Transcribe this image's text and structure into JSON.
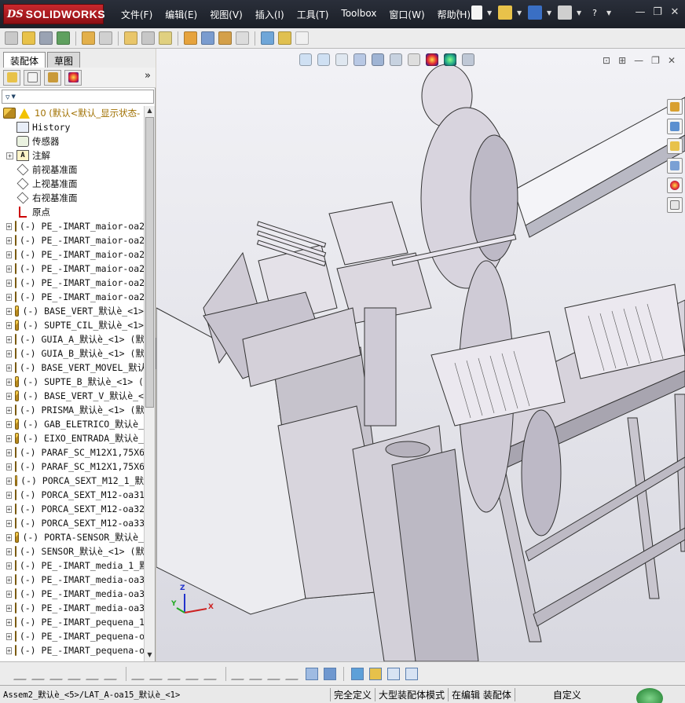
{
  "app": {
    "logo_ds": "DS",
    "logo_name": "SOLIDWORKS"
  },
  "menu": [
    "文件(F)",
    "编辑(E)",
    "视图(V)",
    "插入(I)",
    "工具(T)",
    "Toolbox",
    "窗口(W)",
    "帮助(H)"
  ],
  "window_buttons": {
    "minimize": "—",
    "restore": "❐",
    "close": "✕"
  },
  "panel": {
    "tabs": [
      "装配体",
      "草图"
    ],
    "active_tab": 0,
    "expand_label": "»",
    "filter_icon": "▼"
  },
  "tree": {
    "root": "10  (默认<默认_显示状态-",
    "items": [
      {
        "icon": "history-icon",
        "label": "History",
        "expand": false
      },
      {
        "icon": "sensor-icon",
        "label": "传感器",
        "expand": false
      },
      {
        "icon": "annotation-icon",
        "label": "注解",
        "expand": true
      },
      {
        "icon": "plane-icon",
        "label": "前视基准面",
        "expand": false
      },
      {
        "icon": "plane-icon",
        "label": "上视基准面",
        "expand": false
      },
      {
        "icon": "plane-icon",
        "label": "右视基准面",
        "expand": false
      },
      {
        "icon": "origin-icon",
        "label": "原点",
        "expand": false
      },
      {
        "icon": "part-icon",
        "label": "(-) PE_-IMART_maior-oa2",
        "expand": true
      },
      {
        "icon": "part-icon",
        "label": "(-) PE_-IMART_maior-oa2",
        "expand": true
      },
      {
        "icon": "part-icon",
        "label": "(-) PE_-IMART_maior-oa2",
        "expand": true
      },
      {
        "icon": "part-icon",
        "label": "(-) PE_-IMART_maior-oa2",
        "expand": true
      },
      {
        "icon": "part-icon",
        "label": "(-) PE_-IMART_maior-oa2",
        "expand": true
      },
      {
        "icon": "part-icon",
        "label": "(-) PE_-IMART_maior-oa2",
        "expand": true
      },
      {
        "icon": "part-icon",
        "label": "(-) BASE_VERT_默认è_<1>",
        "expand": true
      },
      {
        "icon": "part-icon",
        "label": "(-) SUPTE_CIL_默认è_<1>",
        "expand": true
      },
      {
        "icon": "part-icon",
        "label": "(-) GUIA_A_默认è_<1> (默",
        "expand": true
      },
      {
        "icon": "part-icon",
        "label": "(-) GUIA_B_默认è_<1> (默",
        "expand": true
      },
      {
        "icon": "part-icon",
        "label": "(-) BASE_VERT_MOVEL_默认",
        "expand": true
      },
      {
        "icon": "part-icon",
        "label": "(-) SUPTE_B_默认è_<1> (",
        "expand": true
      },
      {
        "icon": "part-icon",
        "label": "(-) BASE_VERT_V_默认è_<",
        "expand": true
      },
      {
        "icon": "part-icon",
        "label": "(-) PRISMA_默认è_<1> (默",
        "expand": true
      },
      {
        "icon": "part-icon",
        "label": "(-) GAB_ELETRICO_默认è_",
        "expand": true
      },
      {
        "icon": "part-icon",
        "label": "(-) EIXO_ENTRADA_默认è_",
        "expand": true
      },
      {
        "icon": "part-icon",
        "label": "(-) PARAF_SC_M12X1,75X6",
        "expand": true
      },
      {
        "icon": "part-icon",
        "label": "(-) PARAF_SC_M12X1,75X6",
        "expand": true
      },
      {
        "icon": "part-icon",
        "label": "(-) PORCA_SEXT_M12_1_默",
        "expand": true
      },
      {
        "icon": "part-icon",
        "label": "(-) PORCA_SEXT_M12-oa31",
        "expand": true
      },
      {
        "icon": "part-icon",
        "label": "(-) PORCA_SEXT_M12-oa32",
        "expand": true
      },
      {
        "icon": "part-icon",
        "label": "(-) PORCA_SEXT_M12-oa33",
        "expand": true
      },
      {
        "icon": "part-icon",
        "label": "(-) PORTA-SENSOR_默认è_",
        "expand": true
      },
      {
        "icon": "part-icon",
        "label": "(-) SENSOR_默认è_<1> (默",
        "expand": true
      },
      {
        "icon": "part-icon",
        "label": "(-) PE_-IMART_media_1_默",
        "expand": true
      },
      {
        "icon": "part-icon",
        "label": "(-) PE_-IMART_media-oa3",
        "expand": true
      },
      {
        "icon": "part-icon",
        "label": "(-) PE_-IMART_media-oa3",
        "expand": true
      },
      {
        "icon": "part-icon",
        "label": "(-) PE_-IMART_media-oa3",
        "expand": true
      },
      {
        "icon": "part-icon",
        "label": "(-) PE_-IMART_pequena_1",
        "expand": true
      },
      {
        "icon": "part-icon",
        "label": "(-) PE_-IMART_pequena-o",
        "expand": true
      },
      {
        "icon": "part-icon",
        "label": "(-) PE_-IMART_pequena-o",
        "expand": true
      }
    ]
  },
  "triad": {
    "x": "X",
    "y": "Y",
    "z": "Z"
  },
  "status": {
    "path": "Assem2_默认è_<5>/LAT_A-oa15_默认è_<1>",
    "definition": "完全定义",
    "mode": "大型装配体模式",
    "editing": "在编辑 装配体",
    "units": "自定义"
  }
}
